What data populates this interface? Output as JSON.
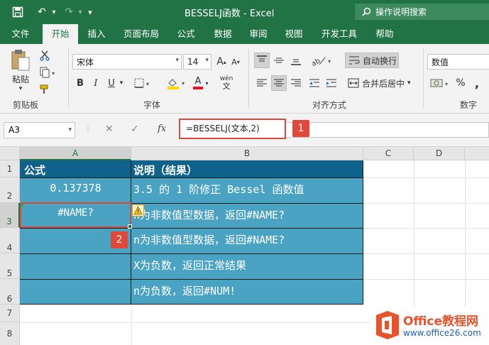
{
  "titlebar": {
    "title": "BESSELJ函数 - Excel",
    "search_placeholder": "操作说明搜索",
    "undo": "↶",
    "redo": "↷",
    "customize": "▾"
  },
  "tabs": [
    {
      "label": "文件"
    },
    {
      "label": "开始"
    },
    {
      "label": "插入"
    },
    {
      "label": "页面布局"
    },
    {
      "label": "公式"
    },
    {
      "label": "数据"
    },
    {
      "label": "审阅"
    },
    {
      "label": "视图"
    },
    {
      "label": "开发工具"
    },
    {
      "label": "帮助"
    }
  ],
  "ribbon": {
    "paste_label": "粘贴",
    "clipboard_group": "剪贴板",
    "font_name": "宋体",
    "font_size": "14",
    "font_group": "字体",
    "bold": "B",
    "italic": "I",
    "underline": "U",
    "grow_font": "A",
    "shrink_font": "A",
    "font_color_letter": "A",
    "phonetic": "wén",
    "wrap_text": "自动换行",
    "merge_center": "合并后居中",
    "align_group": "对齐方式",
    "number_format": "数值",
    "percent": "%",
    "comma": ",",
    "number_group": "数字",
    "colors": {
      "font_red": "#e81123",
      "fill_yellow": "#ffd800"
    }
  },
  "formula_bar": {
    "name_box": "A3",
    "fx": "fx",
    "formula": "=BESSELJ(文本,2)",
    "cancel": "✕",
    "enter": "✓"
  },
  "sheet": {
    "columns": [
      "A",
      "B",
      "C",
      "D",
      "E"
    ],
    "rows": [
      "1",
      "2",
      "3",
      "4",
      "5",
      "6",
      "7",
      "8"
    ],
    "cells": {
      "A1": "公式",
      "B1": "说明（结果）",
      "A2": "0.137378",
      "B2": "3.5 的 1 阶修正 Bessel 函数值",
      "A3": "#NAME?",
      "B3": "n为非数值型数据，返回#NAME?",
      "B4": "n为非数值型数据，返回#NAME?",
      "B5": "X为负数，返回正常结果",
      "B6": "n为负数，返回#NUM!"
    }
  },
  "callouts": {
    "one": "1",
    "two": "2"
  },
  "logo": {
    "name": "Office教程网",
    "url": "www.office26.com"
  },
  "colors": {
    "accent": "#217346",
    "table_header": "#0f6289",
    "table_body": "#4aa3c2",
    "callout_red": "#e0483a"
  }
}
